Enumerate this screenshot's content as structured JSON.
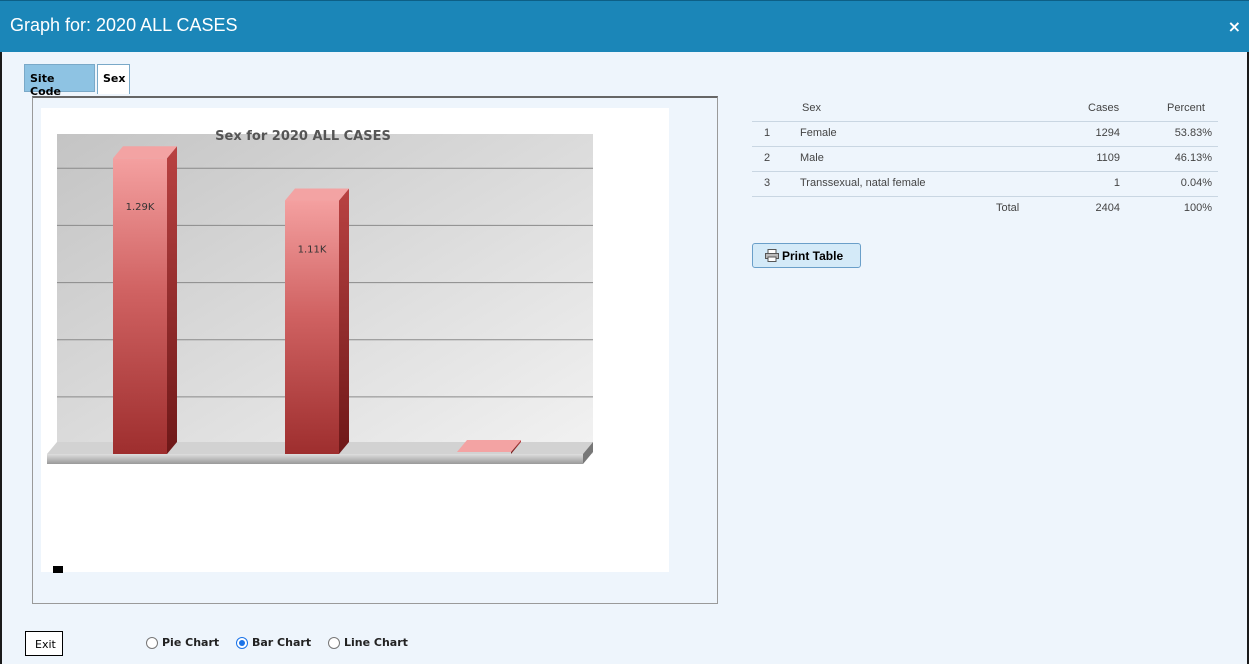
{
  "window": {
    "title": "Graph for: 2020 ALL CASES",
    "close_icon": "×"
  },
  "tabs": [
    {
      "label": "Site Code"
    },
    {
      "label": "Sex"
    }
  ],
  "chart": {
    "title": "Sex for 2020 ALL CASES",
    "bar_labels": [
      "1.29K",
      "1.11K"
    ]
  },
  "chart_data": {
    "type": "bar",
    "title": "Sex for 2020 ALL CASES",
    "categories": [
      "Female",
      "Male",
      "Transsexual, natal female"
    ],
    "values": [
      1294,
      1109,
      1
    ],
    "data_labels": [
      "1.29K",
      "1.11K",
      ""
    ],
    "ylim": [
      0,
      1400
    ],
    "grid": true,
    "style": "3d",
    "colors": {
      "bar_front": "#c44a4a",
      "bar_side": "#8f2323"
    }
  },
  "table": {
    "headers": {
      "sex": "Sex",
      "cases": "Cases",
      "percent": "Percent"
    },
    "rows": [
      {
        "num": "1",
        "sex": "Female",
        "cases": "1294",
        "percent": "53.83%"
      },
      {
        "num": "2",
        "sex": "Male",
        "cases": "1109",
        "percent": "46.13%"
      },
      {
        "num": "3",
        "sex": "Transsexual, natal female",
        "cases": "1",
        "percent": "0.04%"
      }
    ],
    "total": {
      "label": "Total",
      "cases": "2404",
      "percent": "100%"
    }
  },
  "buttons": {
    "print_table": "Print Table",
    "exit": "Exit"
  },
  "chart_types": [
    {
      "label": "Pie Chart",
      "selected": false
    },
    {
      "label": "Bar Chart",
      "selected": true
    },
    {
      "label": "Line Chart",
      "selected": false
    }
  ]
}
